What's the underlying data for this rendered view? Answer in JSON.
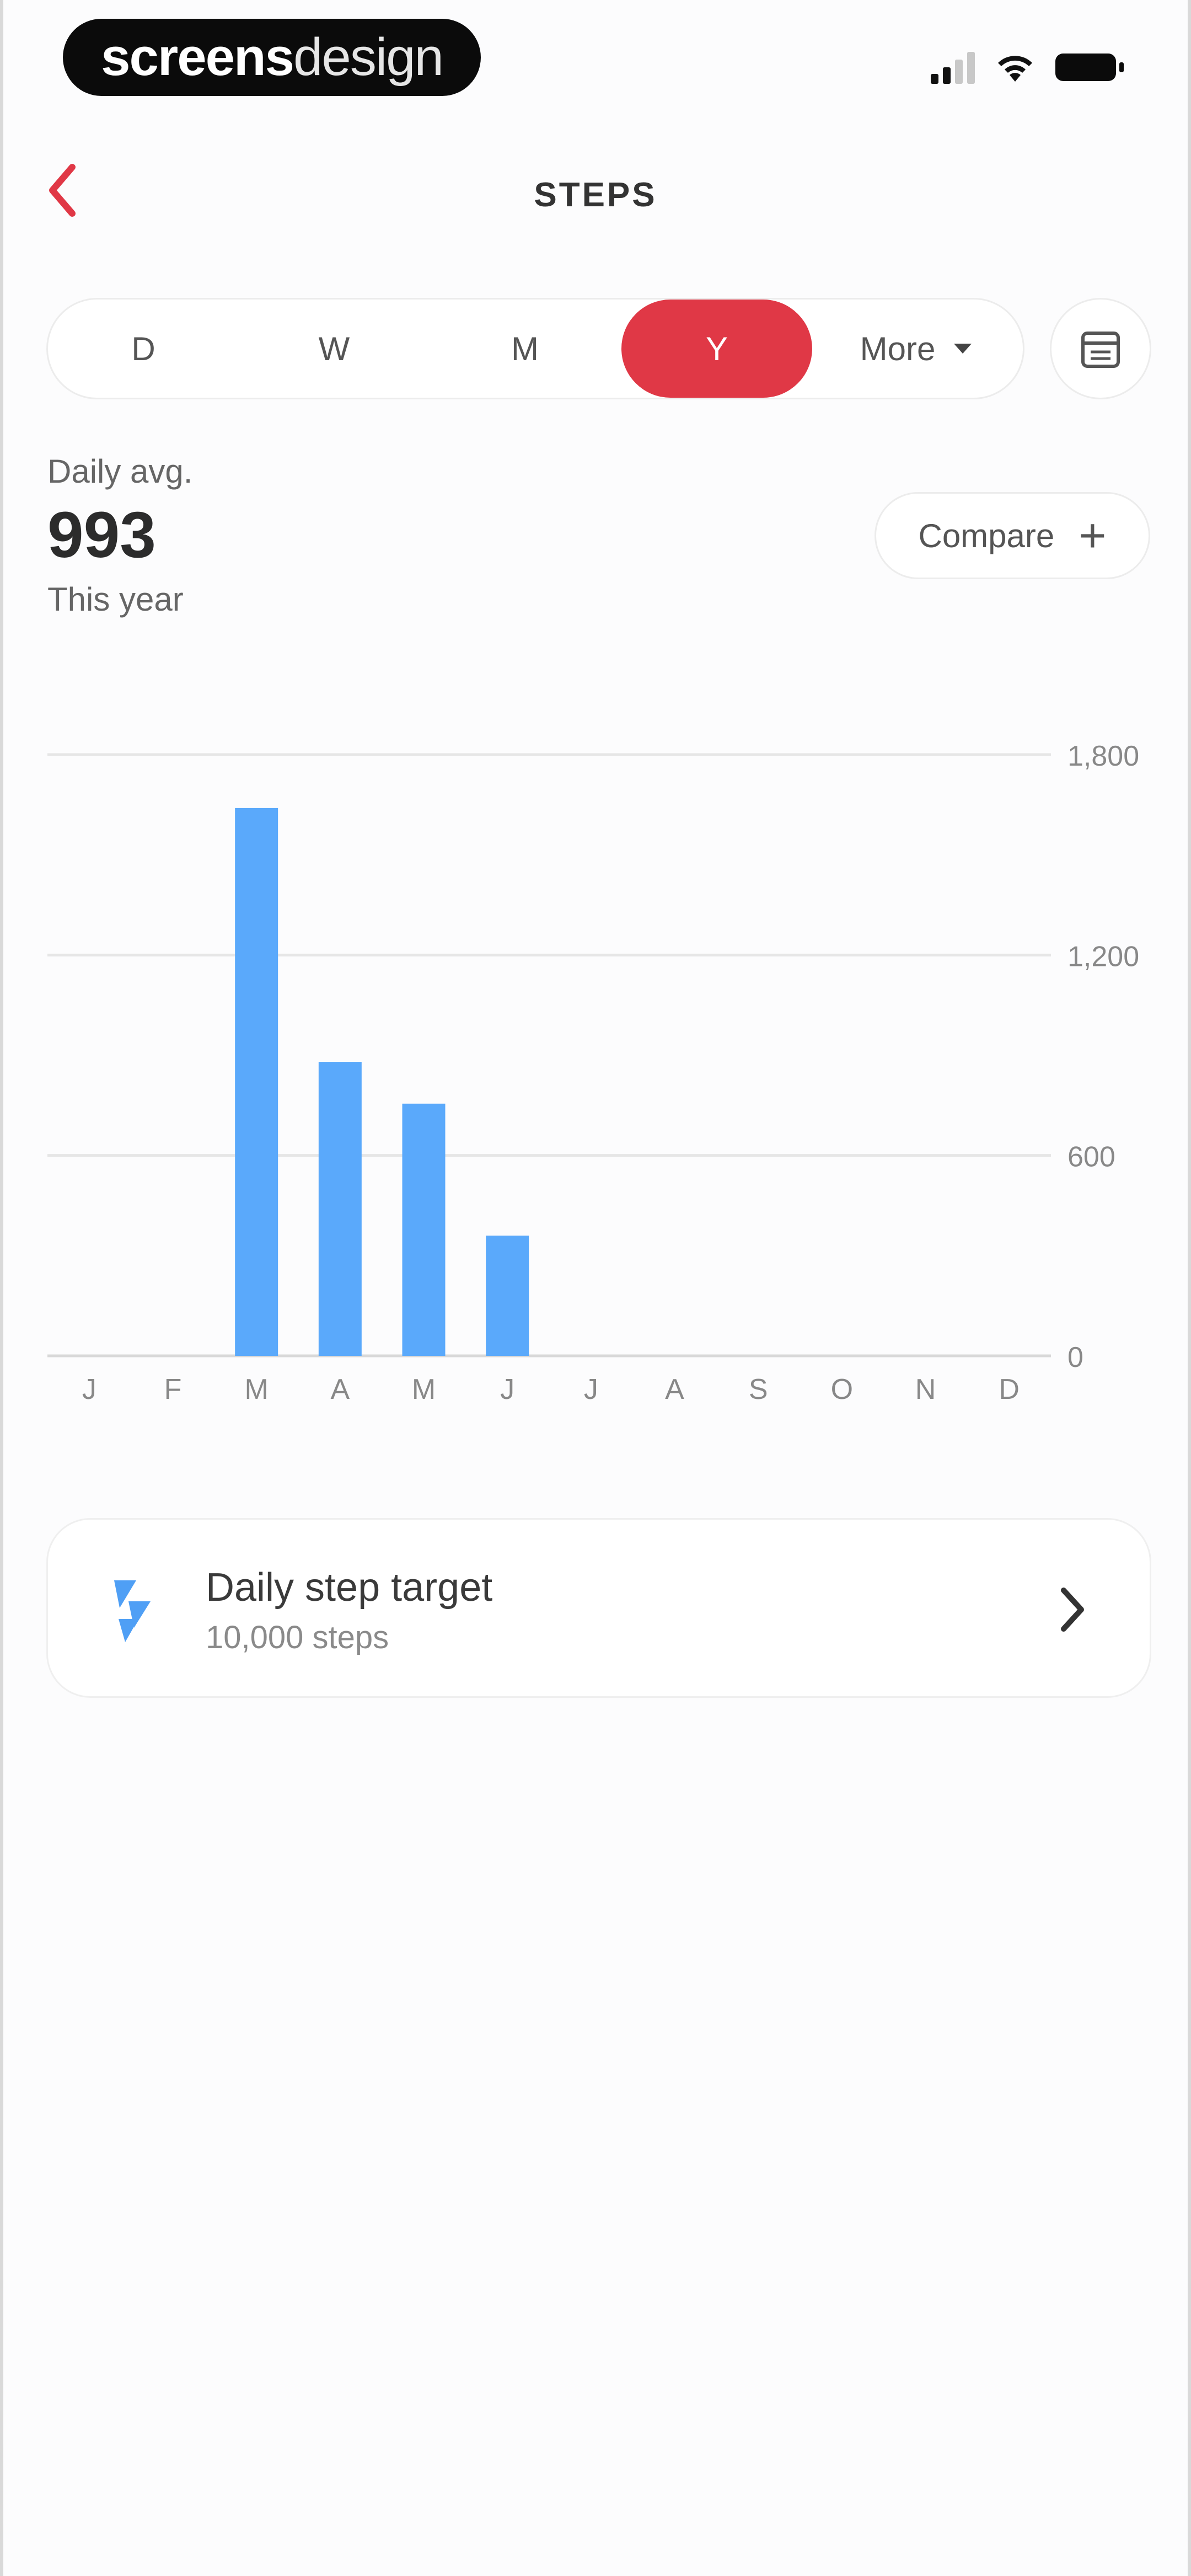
{
  "status_bar": {
    "watermark_bold": "screens",
    "watermark_light": "design"
  },
  "header": {
    "back_icon": "chevron-left-icon",
    "title": "STEPS",
    "accent_color": "#e03846"
  },
  "period_tabs": {
    "items": [
      {
        "label": "D",
        "active": false
      },
      {
        "label": "W",
        "active": false
      },
      {
        "label": "M",
        "active": false
      },
      {
        "label": "Y",
        "active": true
      },
      {
        "label": "More",
        "active": false
      }
    ],
    "calendar_icon": "calendar-icon"
  },
  "summary": {
    "label": "Daily avg.",
    "value": "993",
    "period": "This year",
    "compare_label": "Compare",
    "compare_icon": "plus-icon"
  },
  "chart_data": {
    "type": "bar",
    "categories": [
      "J",
      "F",
      "M",
      "A",
      "M",
      "J",
      "J",
      "A",
      "S",
      "O",
      "N",
      "D"
    ],
    "values": [
      0,
      0,
      1640,
      880,
      755,
      360,
      0,
      0,
      0,
      0,
      0,
      0
    ],
    "ylim": [
      0,
      1800
    ],
    "yticks": [
      0,
      600,
      1200,
      1800
    ],
    "ytick_labels": [
      "0",
      "600",
      "1,200",
      "1,800"
    ],
    "grid": true,
    "bar_color": "#5aa9fb",
    "grid_color": "#e6e6e6"
  },
  "target_card": {
    "icon": "steps-icon",
    "title": "Daily step target",
    "subtitle": "10,000 steps",
    "chevron_icon": "chevron-right-icon"
  }
}
